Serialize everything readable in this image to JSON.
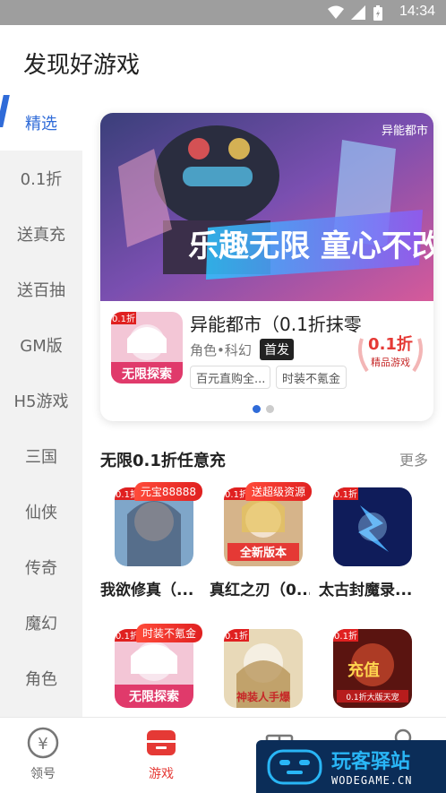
{
  "status_bar": {
    "time": "14:34"
  },
  "page_title": "发现好游戏",
  "sidebar": {
    "items": [
      {
        "label": "精选",
        "active": true
      },
      {
        "label": "0.1折"
      },
      {
        "label": "送真充"
      },
      {
        "label": "送百抽"
      },
      {
        "label": "GM版"
      },
      {
        "label": "H5游戏"
      },
      {
        "label": "三国"
      },
      {
        "label": "仙侠"
      },
      {
        "label": "传奇"
      },
      {
        "label": "魔幻"
      },
      {
        "label": "角色"
      }
    ]
  },
  "banner": {
    "game_name": "异能都市（0.1折抹零",
    "genre": "角色•科幻",
    "badge": "首发",
    "tags": [
      "百元直购全...",
      "时装不氪金"
    ],
    "seal_big": "0.1折",
    "seal_small": "精品游戏",
    "artwork_text": "乐趣无限 童心不改",
    "accent": "#2f6bd8"
  },
  "section": {
    "title": "无限0.1折任意充",
    "more": "更多"
  },
  "games": [
    {
      "name": "我欲修真（...",
      "badge": "元宝88888"
    },
    {
      "name": "真红之刃（0...",
      "badge": "送超级资源"
    },
    {
      "name": "太古封魔录...",
      "badge": ""
    },
    {
      "name": "",
      "badge": "时装不氪金"
    },
    {
      "name": "",
      "badge": ""
    },
    {
      "name": "",
      "badge": ""
    }
  ],
  "tabbar": {
    "items": [
      {
        "label": "领号",
        "icon": "gift-coin-icon"
      },
      {
        "label": "游戏",
        "icon": "game-store-icon",
        "active": true
      },
      {
        "label": "",
        "icon": "gift-box-icon"
      },
      {
        "label": "",
        "icon": "user-icon"
      }
    ]
  },
  "watermark": {
    "line1": "玩客驿站",
    "line2": "WODEGAME.CN"
  }
}
